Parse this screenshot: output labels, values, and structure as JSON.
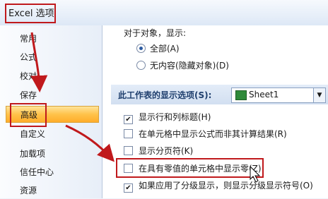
{
  "window": {
    "title": "Excel 选项"
  },
  "sidebar": {
    "items": [
      {
        "label": "常用"
      },
      {
        "label": "公式"
      },
      {
        "label": "校对"
      },
      {
        "label": "保存"
      },
      {
        "label": "高级",
        "active": true
      },
      {
        "label": "自定义"
      },
      {
        "label": "加载项"
      },
      {
        "label": "信任中心"
      },
      {
        "label": "资源"
      }
    ]
  },
  "main": {
    "object_display_label": "对于对象，显示:",
    "radio_all": "全部(A)",
    "radio_none": "无内容(隐藏对象)(D)",
    "sheet_section_label": "此工作表的显示选项(S):",
    "sheet_select_value": "Sheet1",
    "options": [
      {
        "label": "显示行和列标题(H)",
        "checked": true
      },
      {
        "label": "在单元格中显示公式而非其计算结果(R)",
        "checked": false
      },
      {
        "label": "显示分页符(K)",
        "checked": false
      },
      {
        "label": "在具有零值的单元格中显示零(Z)",
        "checked": false
      },
      {
        "label": "如果应用了分级显示，则显示分级显示符号(O)",
        "checked": true
      }
    ]
  },
  "colors": {
    "highlight_red": "#c0191c",
    "active_orange": "#ffc24a"
  }
}
